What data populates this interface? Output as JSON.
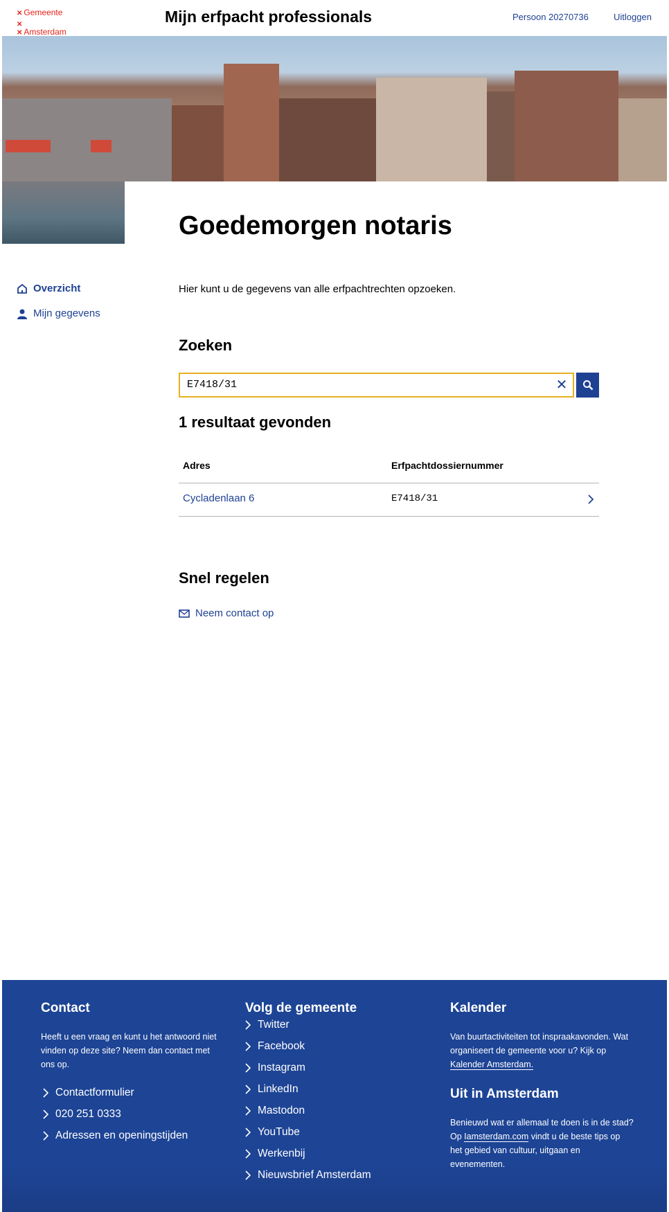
{
  "header": {
    "logo_line1": "Gemeente",
    "logo_line2": "Amsterdam",
    "title": "Mijn erfpacht professionals",
    "user": "Persoon 20270736",
    "logout": "Uitloggen"
  },
  "page": {
    "greeting": "Goedemorgen notaris",
    "intro": "Hier kunt u de gegevens van alle erfpachtrechten opzoeken."
  },
  "sidebar": {
    "items": [
      {
        "label": "Overzicht",
        "icon": "home-icon"
      },
      {
        "label": "Mijn gegevens",
        "icon": "user-icon"
      }
    ]
  },
  "search": {
    "heading": "Zoeken",
    "value": "E7418/31"
  },
  "results": {
    "heading": "1 resultaat gevonden",
    "columns": [
      "Adres",
      "Erfpachtdossiernummer"
    ],
    "rows": [
      {
        "adres": "Cycladenlaan 6",
        "dossier": "E7418/31"
      }
    ]
  },
  "quick": {
    "heading": "Snel regelen",
    "contact": "Neem contact op"
  },
  "footer": {
    "contact": {
      "heading": "Contact",
      "text": "Heeft u een vraag en kunt u het antwoord niet vinden op deze site? Neem dan contact met ons op.",
      "links": [
        "Contactformulier",
        "020 251 0333",
        "Adressen en openingstijden"
      ]
    },
    "follow": {
      "heading": "Volg de gemeente",
      "links": [
        "Twitter",
        "Facebook",
        "Instagram",
        "LinkedIn",
        "Mastodon",
        "YouTube",
        "Werkenbij",
        "Nieuwsbrief Amsterdam"
      ]
    },
    "calendar": {
      "heading": "Kalender",
      "text1": "Van buurtactiviteiten tot inspraakavonden. Wat organiseert de gemeente voor u? Kijk op ",
      "link": "Kalender Amsterdam."
    },
    "uit": {
      "heading": "Uit in Amsterdam",
      "text1": "Benieuwd wat er allemaal te doen is in de stad? Op ",
      "link": "Iamsterdam.com",
      "text2": " vindt u de beste tips op het gebied van cultuur, uitgaan en evenementen."
    }
  },
  "colors": {
    "brand_blue": "#1e4193",
    "logo_red": "#e4251b",
    "focus": "#e8b020"
  }
}
